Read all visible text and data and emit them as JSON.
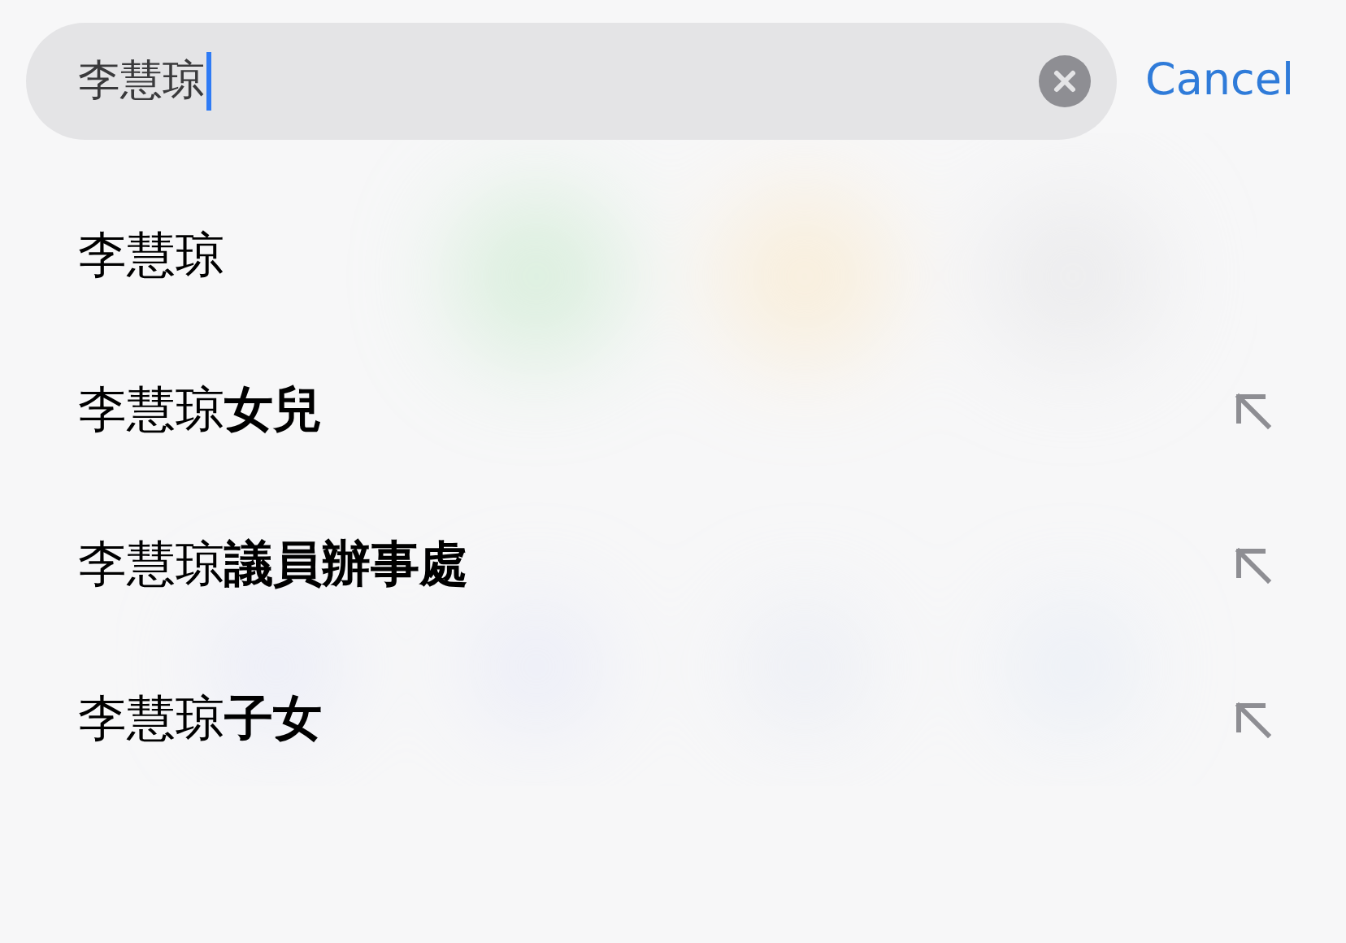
{
  "search": {
    "value": "李慧琼",
    "cancel": "Cancel"
  },
  "suggestions": [
    {
      "text": "李慧琼",
      "kind": "plain"
    },
    {
      "text": "李慧琼**女兒**",
      "kind": "completion"
    },
    {
      "text": "李慧琼**議員辦事處**",
      "kind": "completion"
    },
    {
      "text": "李慧琼**子女**",
      "kind": "completion"
    }
  ]
}
